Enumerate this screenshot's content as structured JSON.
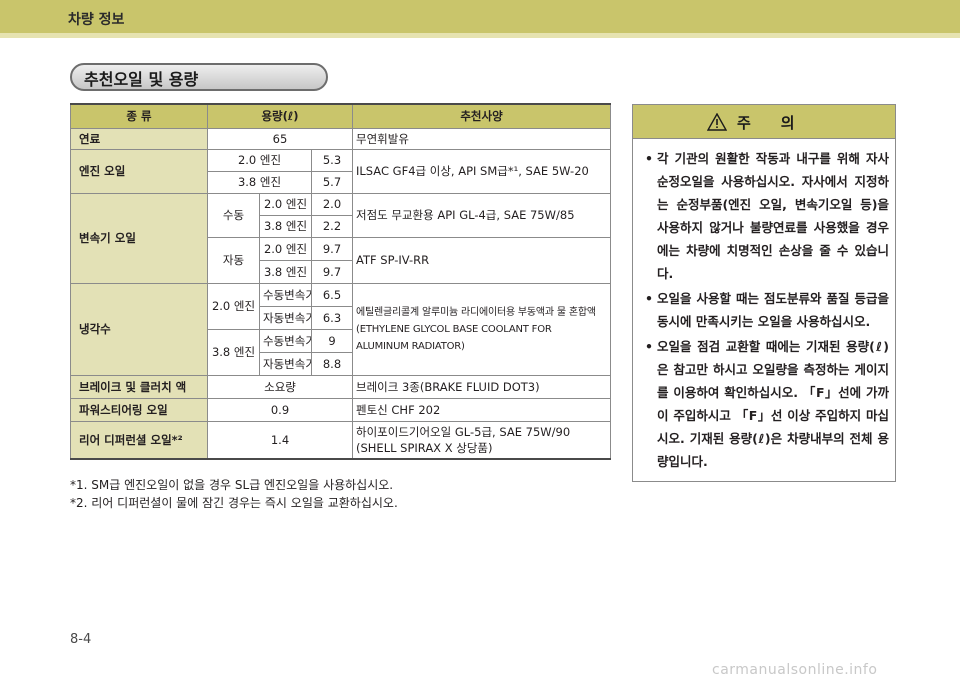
{
  "header": {
    "title": "차량 정보"
  },
  "section": {
    "title": "추천오일 및 용량"
  },
  "table": {
    "headers": [
      "종 류",
      "용량(ℓ)",
      "추천사양"
    ],
    "rows": {
      "fuel": {
        "category": "연료",
        "capacity": "65",
        "spec": "무연휘발유"
      },
      "engine_oil": {
        "category": "엔진 오일",
        "engine_2_0": "2.0 엔진",
        "cap_2_0": "5.3",
        "engine_3_8": "3.8 엔진",
        "cap_3_8": "5.7",
        "spec": "ILSAC GF4급 이상, API SM급*¹, SAE 5W-20"
      },
      "trans_oil": {
        "category": "변속기 오일",
        "manual": "수동",
        "m_2_0": "2.0 엔진",
        "m_2_0_cap": "2.0",
        "m_3_8": "3.8 엔진",
        "m_3_8_cap": "2.2",
        "manual_spec": "저점도 무교환용 API GL-4급,  SAE 75W/85",
        "auto": "자동",
        "a_2_0": "2.0 엔진",
        "a_2_0_cap": "9.7",
        "a_3_8": "3.8 엔진",
        "a_3_8_cap": "9.7",
        "auto_spec": "ATF SP-IV-RR"
      },
      "coolant": {
        "category": "냉각수",
        "e_2_0": "2.0 엔진",
        "e_2_0_manual": "수동변속기",
        "e_2_0_manual_cap": "6.5",
        "e_2_0_auto": "자동변속기",
        "e_2_0_auto_cap": "6.3",
        "e_3_8": "3.8 엔진",
        "e_3_8_manual": "수동변속기",
        "e_3_8_manual_cap": "9",
        "e_3_8_auto": "자동변속기",
        "e_3_8_auto_cap": "8.8",
        "spec": "에틸렌글리콜계 알루미늄 라디에이터용 부동액과 물 혼합액 (ETHYLENE GLYCOL BASE COOLANT FOR ALUMINUM RADIATOR)"
      },
      "brake": {
        "category": "브레이크 및 클러치 액",
        "capacity": "소요량",
        "spec": "브레이크 3종(BRAKE FLUID DOT3)"
      },
      "power_steering": {
        "category": "파워스티어링 오일",
        "capacity": "0.9",
        "spec": "펜토신 CHF 202"
      },
      "rear_diff": {
        "category": "리어 디퍼런셜 오일*²",
        "capacity": "1.4",
        "spec": "하이포이드기어오일 GL-5급, SAE 75W/90 (SHELL SPIRAX X 상당품)"
      }
    }
  },
  "footnotes": [
    "*1. SM급 엔진오일이 없을 경우 SL급 엔진오일을 사용하십시오.",
    "*2. 리어 디퍼런셜이 물에 잠긴 경우는 즉시 오일을 교환하십시오."
  ],
  "caution": {
    "icon": "warning-triangle-icon",
    "title": "주의",
    "items": [
      "각 기관의 원활한 작동과 내구를 위해 자사 순정오일을 사용하십시오. 자사에서 지정하는 순정부품(엔진 오일, 변속기오일 등)을 사용하지 않거나 불량연료를 사용했을 경우에는 차량에 치명적인 손상을 줄 수 있습니다.",
      "오일을 사용할 때는 점도분류와 품질 등급을 동시에 만족시키는 오일을 사용하십시오.",
      "오일을 점검 교환할 때에는 기재된 용량(ℓ)은 참고만 하시고 오일량을 측정하는 게이지를 이용하여 확인하십시오. 「F」선에 가까이 주입하시고 「F」선 이상 주입하지 마십시오. 기재된 용량(ℓ)은 차량내부의 전체 용량입니다."
    ]
  },
  "footer": {
    "page_number": "8-4",
    "watermark": "carmanualsonline.info"
  },
  "colors": {
    "accent": "#c9c56b",
    "category_bg": "#e3e1b6",
    "border": "#8b8b8b"
  }
}
